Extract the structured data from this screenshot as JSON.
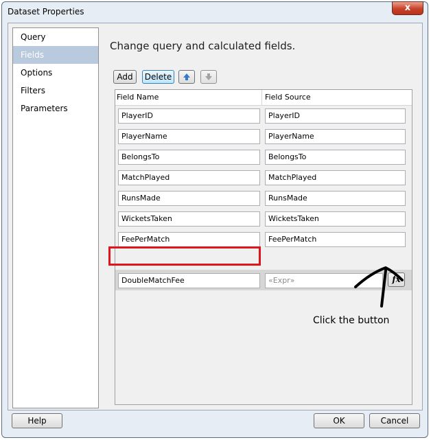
{
  "window": {
    "title": "Dataset Properties",
    "close_label": "x"
  },
  "sidebar": {
    "items": [
      {
        "label": "Query"
      },
      {
        "label": "Fields",
        "selected": true
      },
      {
        "label": "Options"
      },
      {
        "label": "Filters"
      },
      {
        "label": "Parameters"
      }
    ]
  },
  "main": {
    "heading": "Change query and calculated fields.",
    "toolbar": {
      "add_label": "Add",
      "delete_label": "Delete",
      "move_up_icon": "arrow-up-icon",
      "move_down_icon": "arrow-down-icon"
    },
    "grid": {
      "columns": [
        "Field Name",
        "Field Source"
      ],
      "rows": [
        {
          "name": "PlayerID",
          "source": "PlayerID"
        },
        {
          "name": "PlayerName",
          "source": "PlayerName"
        },
        {
          "name": "BelongsTo",
          "source": "BelongsTo"
        },
        {
          "name": "MatchPlayed",
          "source": "MatchPlayed"
        },
        {
          "name": "RunsMade",
          "source": "RunsMade"
        },
        {
          "name": "WicketsTaken",
          "source": "WicketsTaken"
        },
        {
          "name": "FeePerMatch",
          "source": "FeePerMatch"
        },
        {
          "name": "DoubleMatchFee",
          "source": "«Expr»"
        }
      ],
      "expression_button_label": "fx"
    }
  },
  "annotation": {
    "text": "Click the button",
    "highlight_color": "#e0141b"
  },
  "footer": {
    "help_label": "Help",
    "ok_label": "OK",
    "cancel_label": "Cancel"
  }
}
